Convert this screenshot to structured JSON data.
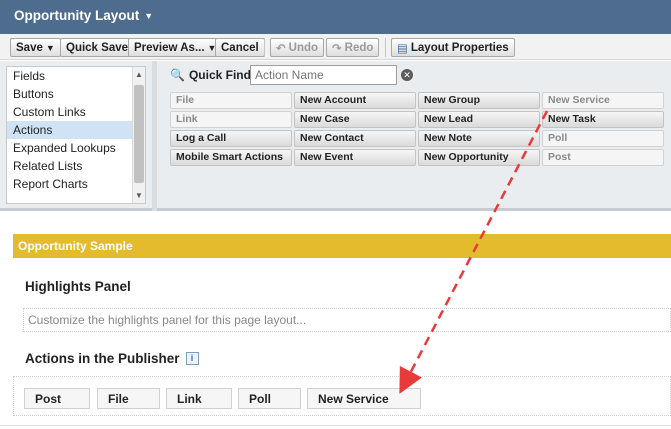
{
  "header": {
    "title": "Opportunity Layout"
  },
  "toolbar": {
    "save": "Save",
    "quick_save": "Quick Save",
    "preview_as": "Preview As...",
    "cancel": "Cancel",
    "undo": "Undo",
    "redo": "Redo",
    "layout_properties": "Layout Properties"
  },
  "palette": {
    "categories": [
      "Fields",
      "Buttons",
      "Custom Links",
      "Actions",
      "Expanded Lookups",
      "Related Lists",
      "Report Charts"
    ],
    "active_category": "Actions",
    "quick_find_label": "Quick Find",
    "quick_find_placeholder": "Action Name",
    "items": [
      {
        "label": "File",
        "used": true
      },
      {
        "label": "New Account",
        "used": false
      },
      {
        "label": "New Group",
        "used": false
      },
      {
        "label": "New Service",
        "used": true
      },
      {
        "label": "Link",
        "used": true
      },
      {
        "label": "New Case",
        "used": false
      },
      {
        "label": "New Lead",
        "used": false
      },
      {
        "label": "New Task",
        "used": false
      },
      {
        "label": "Log a Call",
        "used": false
      },
      {
        "label": "New Contact",
        "used": false
      },
      {
        "label": "New Note",
        "used": false
      },
      {
        "label": "Poll",
        "used": true
      },
      {
        "label": "Mobile Smart Actions",
        "used": false
      },
      {
        "label": "New Event",
        "used": false
      },
      {
        "label": "New Opportunity",
        "used": false
      },
      {
        "label": "Post",
        "used": true
      }
    ]
  },
  "sample": {
    "title": "Opportunity Sample",
    "highlights_title": "Highlights Panel",
    "highlights_placeholder": "Customize the highlights panel for this page layout...",
    "publisher_title": "Actions in the Publisher",
    "publisher_actions": [
      "Post",
      "File",
      "Link",
      "Poll",
      "New Service"
    ]
  },
  "colors": {
    "header": "#4d6c8e",
    "sample_bar": "#e4bb2d",
    "drag_arrow": "#e83a3a"
  }
}
